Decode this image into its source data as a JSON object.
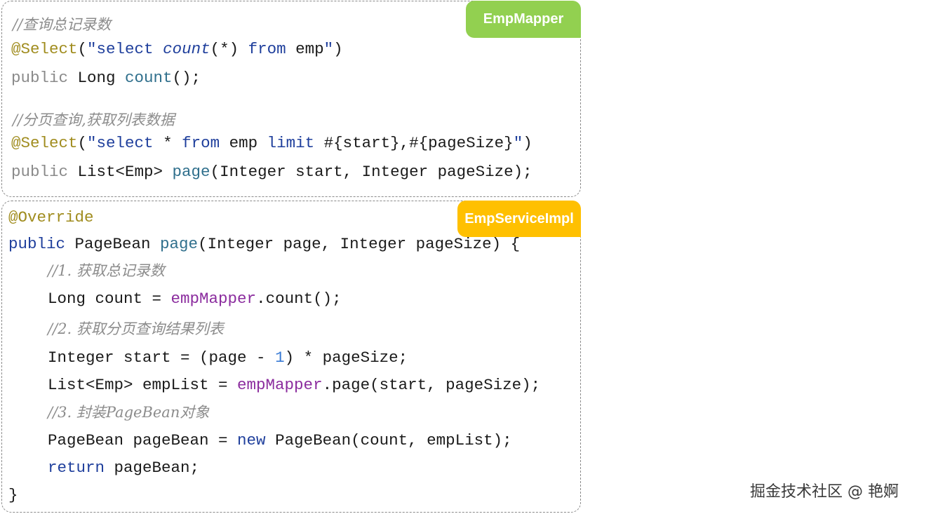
{
  "mapper": {
    "tag": "EmpMapper",
    "c1": "//查询总记录数",
    "l1": {
      "ann": "@Select",
      "p1": "(",
      "s1": "\"select ",
      "s2": "count",
      "s3": "(*) ",
      "s4": "from",
      "s5": " emp",
      "s6": "\"",
      "p2": ")"
    },
    "l2": {
      "k": "public",
      "t1": " Long ",
      "fn": "count",
      "t2": "();"
    },
    "c2": "//分页查询,获取列表数据",
    "l3": {
      "ann": "@Select",
      "p1": "(",
      "s1": "\"select ",
      "s2": "*",
      "s3": " ",
      "s4": "from",
      "s5": " emp ",
      "s6": "limit",
      "s7": " #{start},#{pageSize}",
      "s8": "\"",
      "p2": ")"
    },
    "l4": {
      "k": "public",
      "t1": " List<Emp> ",
      "fn": "page",
      "t2": "(Integer start, Integer pageSize);"
    }
  },
  "service": {
    "tag": "EmpServiceImpl",
    "ann": "@Override",
    "sig": {
      "k": "public",
      "t1": " PageBean ",
      "fn": "page",
      "t2": "(Integer page, Integer pageSize) {"
    },
    "c1": "//1. 获取总记录数",
    "l1": {
      "t1": "Long count = ",
      "f": "empMapper",
      "t2": ".count();"
    },
    "c2": "//2. 获取分页查询结果列表",
    "l2": {
      "t1": "Integer start = (page - ",
      "n": "1",
      "t2": ") * pageSize;"
    },
    "l3": {
      "t1": "List<Emp> empList = ",
      "f": "empMapper",
      "t2": ".page(start, pageSize);"
    },
    "c3": "//3. 封装PageBean对象",
    "l4": {
      "t1": "PageBean pageBean = ",
      "k": "new",
      "t2": " PageBean(count, empList);"
    },
    "l5": {
      "k": "return",
      "t1": " pageBean;"
    },
    "close": "}"
  },
  "watermark": "掘金技术社区 @ 艳婀"
}
